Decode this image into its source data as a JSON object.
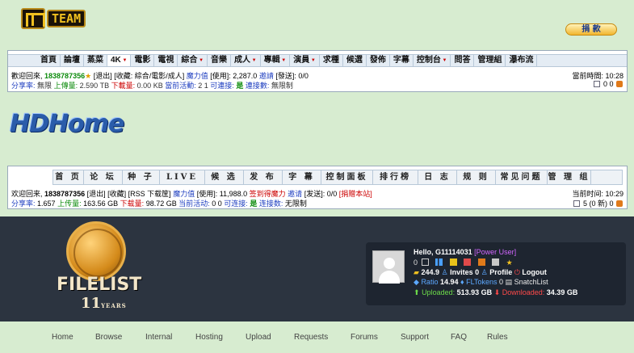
{
  "mteam": {
    "logo_text": "TEAM",
    "donate": "捐  款",
    "menu": [
      {
        "label": "首頁",
        "dd": false,
        "active": false
      },
      {
        "label": "論壇",
        "dd": false,
        "active": false
      },
      {
        "label": "蒸菜",
        "dd": false,
        "active": false
      },
      {
        "label": "4K",
        "dd": true,
        "active": true
      },
      {
        "label": "電影",
        "dd": false,
        "active": false
      },
      {
        "label": "電視",
        "dd": false,
        "active": false
      },
      {
        "label": "綜合",
        "dd": true,
        "active": false
      },
      {
        "label": "音樂",
        "dd": false,
        "active": false
      },
      {
        "label": "成人",
        "dd": true,
        "active": false
      },
      {
        "label": "專輯",
        "dd": true,
        "active": false
      },
      {
        "label": "演員",
        "dd": true,
        "active": false
      },
      {
        "label": "求種",
        "dd": false,
        "active": false
      },
      {
        "label": "候選",
        "dd": false,
        "active": false
      },
      {
        "label": "發佈",
        "dd": false,
        "active": false
      },
      {
        "label": "字幕",
        "dd": false,
        "active": false
      },
      {
        "label": "控制台",
        "dd": true,
        "active": false
      },
      {
        "label": "問答",
        "dd": false,
        "active": false
      },
      {
        "label": "管理組",
        "dd": false,
        "active": false
      },
      {
        "label": "瀑布流",
        "dd": false,
        "active": false
      }
    ],
    "welcome": "歡迎回來,",
    "username": "1838787356",
    "logout": "[退出]",
    "bookmarks": "[收藏: 綜合/電影/成人]",
    "bonus_label": "魔力值",
    "bonus_value": "[使用]: 2,287.0",
    "invite_label": "邀請",
    "invite_value": "[發送]: 0/0",
    "ratio_label": "分享率:",
    "ratio_value": "無限",
    "up_label": "上傳量:",
    "up_value": "2.590 TB",
    "down_label": "下載量:",
    "down_value": "0.00 KB",
    "active_label": "當前活動:",
    "active_value": "2  1",
    "conn_label": "可連接:",
    "conn_value": "是",
    "conns_label": "連接數:",
    "conns_value": "無限制",
    "time_label": "當前時間:",
    "time_value": "10:28",
    "msg_counts": "0  0"
  },
  "hdhome": {
    "logo_text": "HDHome",
    "menu": [
      {
        "label": "首 页",
        "w": 38
      },
      {
        "label": "论 坛",
        "w": 48
      },
      {
        "label": "种 子",
        "w": 46
      },
      {
        "label": "LIVE",
        "w": 56
      },
      {
        "label": "候 选",
        "w": 48
      },
      {
        "label": "发 布",
        "w": 48
      },
      {
        "label": "字 幕",
        "w": 48
      },
      {
        "label": "控制面板",
        "w": 64
      },
      {
        "label": "排行榜",
        "w": 56
      },
      {
        "label": "日 志",
        "w": 48
      },
      {
        "label": "规 则",
        "w": 48
      },
      {
        "label": "常见问题",
        "w": 64
      },
      {
        "label": "管 理 组",
        "w": 54
      }
    ],
    "welcome": "欢迎回来,",
    "username": "1838787356",
    "logout": "[退出]",
    "bookmarks": "[收藏]",
    "rss": "[RSS 下载筐]",
    "bonus_label": "魔力值",
    "bonus_value": "[使用]: 11,988.0",
    "signin": "签到得魔力",
    "invite_label": "邀请",
    "invite_value": "[发送]: 0/0",
    "donate": "[捐赠本站]",
    "ratio_label": "分享率:",
    "ratio_value": "1.657",
    "up_label": "上传量:",
    "up_value": "163.56 GB",
    "down_label": "下载量:",
    "down_value": "98.72 GB",
    "active_label": "当前活动:",
    "active_value": "0  0",
    "conn_label": "可连接:",
    "conn_value": "是",
    "conns_label": "连接数:",
    "conns_value": "无限制",
    "time_label": "当前时间:",
    "time_value": "10:29",
    "msg_counts": "5 (0 新)  0"
  },
  "filelist": {
    "logo_text": "FILELIST",
    "years_num": "11",
    "years_label": "YEARS",
    "hello": "Hello,",
    "username": "G11114031",
    "rank": "[Power User]",
    "msg_count": "0",
    "bonus": "244.9",
    "invites_label": "Invites",
    "invites_value": "0",
    "profile": "Profile",
    "logout": "Logout",
    "ratio_label": "Ratio",
    "ratio_value": "14.94",
    "fltokens_label": "FLTokens",
    "fltokens_value": "0",
    "snatchlist": "SnatchList",
    "uploaded_label": "Uploaded:",
    "uploaded_value": "513.93 GB",
    "downloaded_label": "Downloaded:",
    "downloaded_value": "34.39 GB",
    "nav": [
      {
        "label": "Home",
        "w": 54
      },
      {
        "label": "Browse",
        "w": 62
      },
      {
        "label": "Internal",
        "w": 62
      },
      {
        "label": "Hosting",
        "w": 62
      },
      {
        "label": "Upload",
        "w": 60
      },
      {
        "label": "Requests",
        "w": 70
      },
      {
        "label": "Forums",
        "w": 62
      },
      {
        "label": "Support",
        "w": 62
      },
      {
        "label": "FAQ",
        "w": 45
      },
      {
        "label": "Rules",
        "w": 40
      }
    ]
  }
}
